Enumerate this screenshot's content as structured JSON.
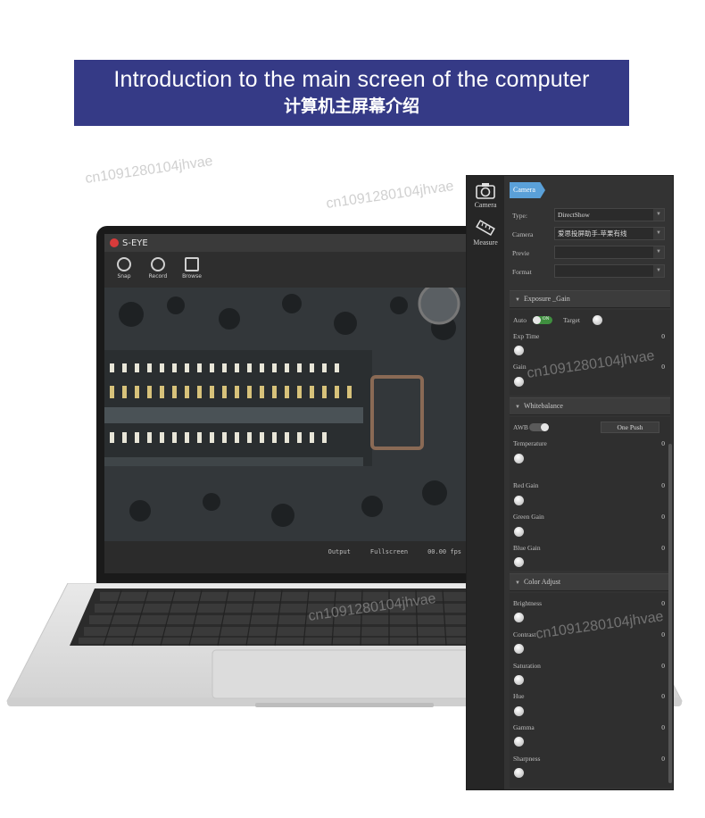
{
  "banner": {
    "title_en": "Introduction to the main screen of the computer",
    "title_zh": "计算机主屏幕介绍"
  },
  "watermark": "cn1091280104jhvae",
  "app": {
    "title": "S-EYE",
    "toolbar": [
      {
        "label": "Snap",
        "icon": "camera-shutter-icon"
      },
      {
        "label": "Record",
        "icon": "record-icon"
      },
      {
        "label": "Browse",
        "icon": "browse-icon"
      }
    ],
    "status": {
      "output": "Output",
      "fullscreen": "Fullscreen",
      "fps": "00.00 fps"
    }
  },
  "panel": {
    "nav": [
      {
        "label": "Camera",
        "icon": "camera-icon"
      },
      {
        "label": "Measure",
        "icon": "ruler-icon"
      }
    ],
    "active_tab": "Camera",
    "camera": {
      "type_label": "Type:",
      "type_value": "DirectShow",
      "camera_label": "Camera",
      "camera_value": "爱思投屏助手-苹果有线",
      "preview_label": "Previe",
      "preview_value": "",
      "format_label": "Format",
      "format_value": ""
    },
    "exposure": {
      "title": "Exposure _Gain",
      "auto_label": "Auto",
      "auto_state": "ON",
      "target_label": "Target",
      "exp_time_label": "Exp Time",
      "exp_time_value": "0",
      "gain_label": "Gain",
      "gain_value": "0"
    },
    "whitebalance": {
      "title": "Whitebalance",
      "awb_label": "AWB",
      "one_push": "One Push",
      "temperature_label": "Temperature",
      "temperature_value": "0",
      "red_label": "Red Gain",
      "red_value": "0",
      "green_label": "Green Gain",
      "green_value": "0",
      "blue_label": "Blue Gain",
      "blue_value": "0"
    },
    "color": {
      "title": "Color Adjust",
      "brightness_label": "Brightness",
      "brightness_value": "0",
      "contrast_label": "Contrast",
      "contrast_value": "0",
      "saturation_label": "Saturation",
      "saturation_value": "0",
      "hue_label": "Hue",
      "hue_value": "0",
      "gamma_label": "Gamma",
      "gamma_value": "0",
      "sharpness_label": "Sharpness",
      "sharpness_value": "0"
    }
  }
}
